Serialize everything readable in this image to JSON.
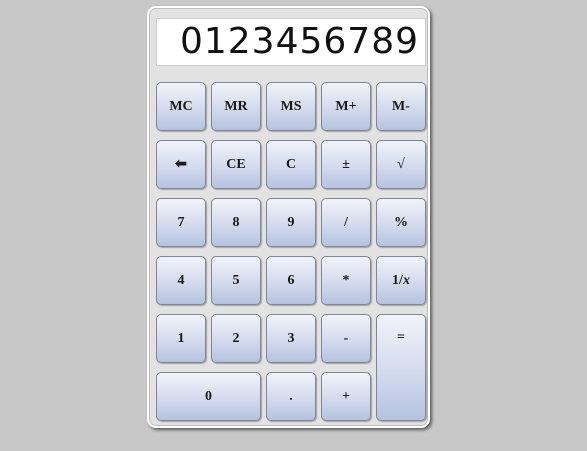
{
  "display": {
    "value": "0123456789"
  },
  "buttons": {
    "mc": "MC",
    "mr": "MR",
    "ms": "MS",
    "m_plus": "M+",
    "m_minus": "M-",
    "backspace": "⬅",
    "ce": "CE",
    "c": "C",
    "plus_minus": "±",
    "sqrt": "√",
    "seven": "7",
    "eight": "8",
    "nine": "9",
    "divide": "/",
    "percent": "%",
    "four": "4",
    "five": "5",
    "six": "6",
    "multiply": "*",
    "reciprocal_prefix": "1/",
    "reciprocal_var": "x",
    "one": "1",
    "two": "2",
    "three": "3",
    "minus": "-",
    "equals": "=",
    "zero": "0",
    "decimal": ".",
    "plus": "+"
  },
  "colors": {
    "background": "#c8c8c8",
    "body": "#e2e2e2",
    "button_top": "#f1f3f8",
    "button_bottom": "#b5c3e0"
  }
}
